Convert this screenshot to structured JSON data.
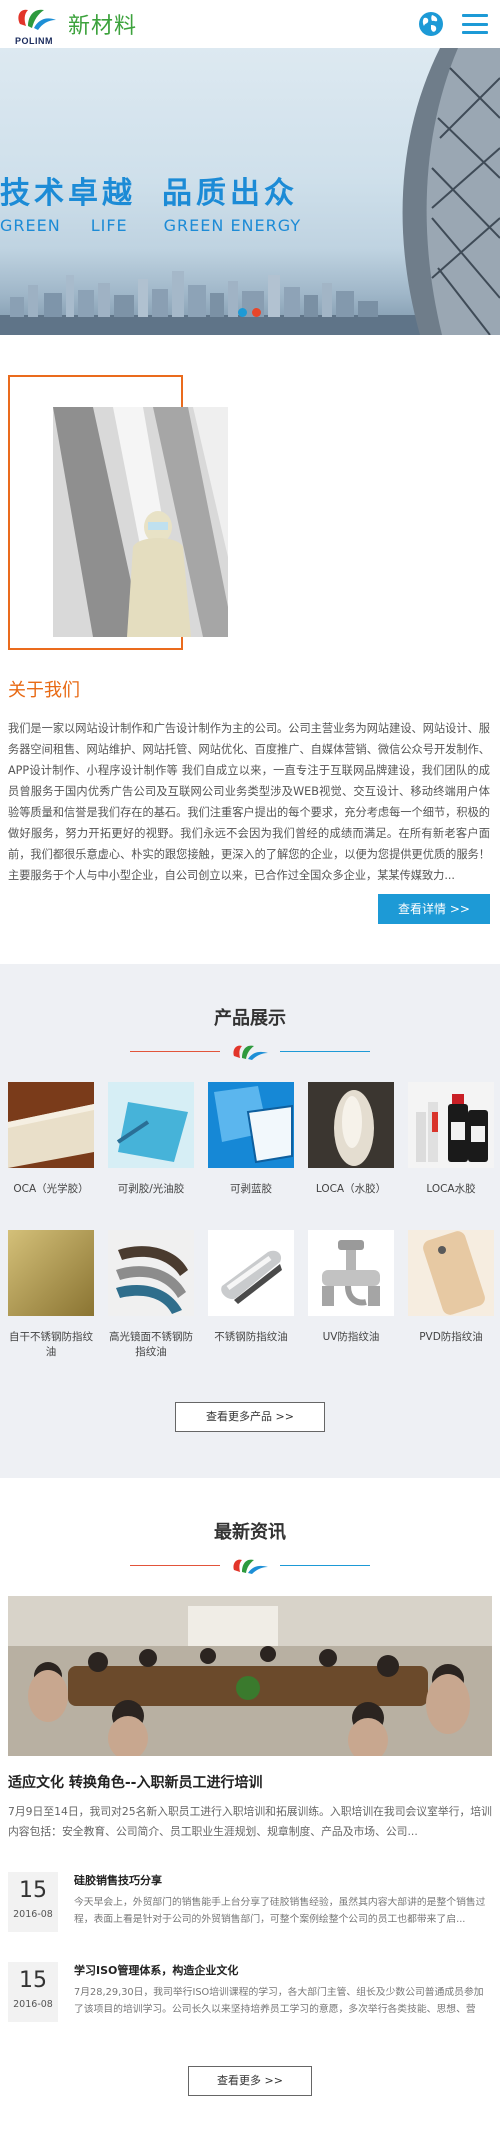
{
  "header": {
    "logo_text": "POLINM",
    "site_name": "新材料",
    "globe_icon": "globe-icon",
    "menu_icon": "hamburger-menu-icon",
    "accent": "#1d9ad6",
    "brand_green": "#3ca23c"
  },
  "banner": {
    "headline_1": "技术卓越",
    "headline_2": "品质出众",
    "sub_1": "GREEN",
    "sub_2": "LIFE",
    "sub_3": "GREEN ENERGY",
    "slide_count": 2,
    "active_slide": 2
  },
  "about": {
    "title": "关于我们",
    "text": "我们是一家以网站设计制作和广告设计制作为主的公司。公司主营业务为网站建设、网站设计、服务器空间租售、网站维护、网站托管、网站优化、百度推广、自媒体营销、微信公众号开发制作、APP设计制作、小程序设计制作等 我们自成立以来，一直专注于互联网品牌建设，我们团队的成员曾服务于国内优秀广告公司及互联网公司业务类型涉及WEB视觉、交互设计、移动终端用户体验等质量和信誉是我们存在的基石。我们注重客户提出的每个要求，充分考虑每一个细节，积极的做好服务，努力开拓更好的视野。我们永远不会因为我们曾经的成绩而满足。在所有新老客户面前，我们都很乐意虚心、朴实的跟您接触，更深入的了解您的企业，以便为您提供更优质的服务！ 主要服务于个人与中小型企业，自公司创立以来，已合作过全国众多企业，某某传媒致力...",
    "more_label": "查看详情 >>",
    "accent": "#ea6b1d"
  },
  "products": {
    "title": "产品展示",
    "items": [
      {
        "name": "OCA（光学胶）"
      },
      {
        "name": "可剥胶/光油胶"
      },
      {
        "name": "可剥蓝胶"
      },
      {
        "name": "LOCA（水胶）"
      },
      {
        "name": "LOCA水胶"
      },
      {
        "name": "自干不锈钢防指纹油"
      },
      {
        "name": "高光镜面不锈钢防指纹油"
      },
      {
        "name": "不锈钢防指纹油"
      },
      {
        "name": "UV防指纹油"
      },
      {
        "name": "PVD防指纹油"
      }
    ],
    "more_label": "查看更多产品 >>"
  },
  "news": {
    "title": "最新资讯",
    "featured": {
      "title": "适应文化 转换角色--入职新员工进行培训",
      "summary": "7月9日至14日，我司对25名新入职员工进行入职培训和拓展训练。入职培训在我司会议室举行，培训内容包括：安全教育、公司简介、员工职业生涯规划、规章制度、产品及市场、公司..."
    },
    "items": [
      {
        "day": "15",
        "ym": "2016-08",
        "title": "硅胶销售技巧分享",
        "text": "今天早会上，外贸部门的销售能手上台分享了硅胶销售经验，虽然其内容大部讲的是整个销售过程，表面上看是针对于公司的外贸销售部门，可整个案例绘整个公司的员工也都带来了启..."
      },
      {
        "day": "15",
        "ym": "2016-08",
        "title": "学习ISO管理体系，构造企业文化",
        "text": "7月28,29,30日，我司举行ISO培训课程的学习，各大部门主管、组长及少数公司普通成员参加了该项目的培训学习。公司长久以来坚持培养员工学习的意愿，多次举行各类技能、思想、营销..."
      }
    ],
    "more_label": "查看更多 >>"
  }
}
